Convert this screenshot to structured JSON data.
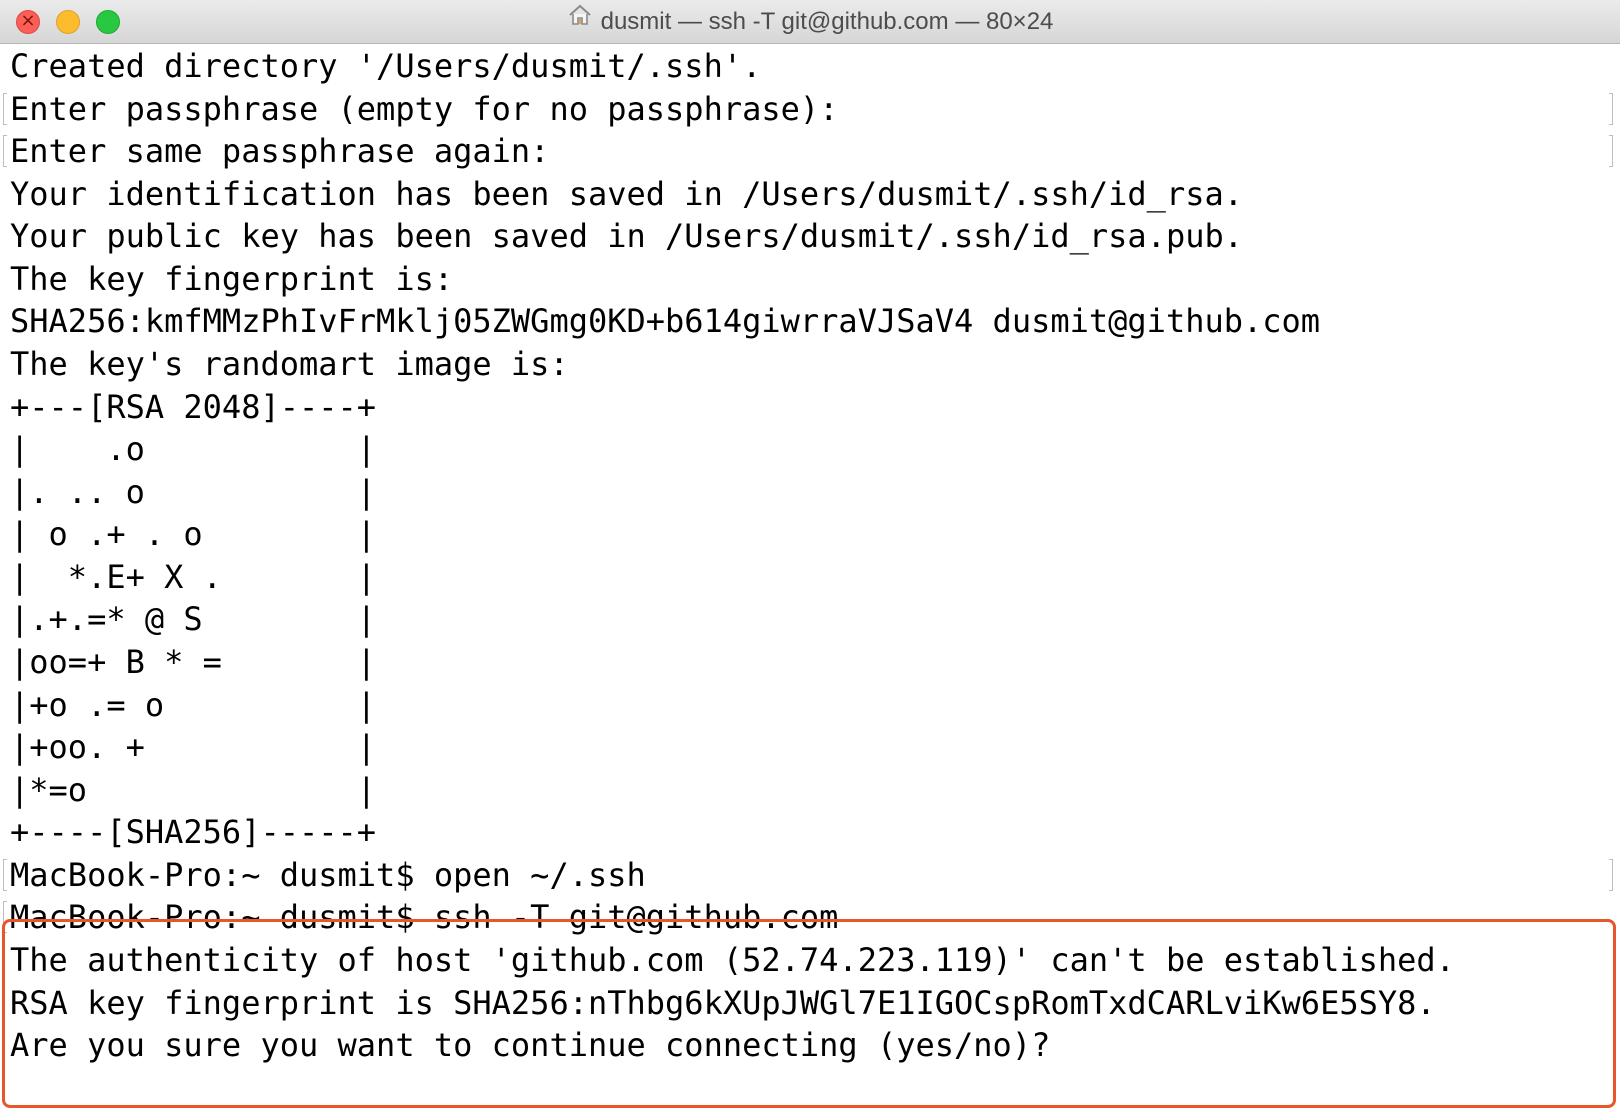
{
  "window": {
    "title": "dusmit — ssh -T git@github.com — 80×24",
    "title_icon": "home-icon",
    "traffic_lights": [
      "close",
      "minimize",
      "zoom"
    ],
    "colors": {
      "close": "#fc5f57",
      "minimize": "#fdbc2e",
      "zoom": "#28c940",
      "highlight_box": "#e8572a"
    }
  },
  "terminal": {
    "lines": [
      "Created directory '/Users/dusmit/.ssh'.",
      "Enter passphrase (empty for no passphrase):",
      "Enter same passphrase again:",
      "Your identification has been saved in /Users/dusmit/.ssh/id_rsa.",
      "Your public key has been saved in /Users/dusmit/.ssh/id_rsa.pub.",
      "The key fingerprint is:",
      "SHA256:kmfMMzPhIvFrMklj05ZWGmg0KD+b614giwrraVJSaV4 dusmit@github.com",
      "The key's randomart image is:",
      "+---[RSA 2048]----+",
      "|    .o           |",
      "|. .. o           |",
      "| o .+ . o        |",
      "|  *.E+ X .       |",
      "|.+.=* @ S        |",
      "|oo=+ B * =       |",
      "|+o .= o          |",
      "|+oo. +           |",
      "|*=o              |",
      "+----[SHA256]-----+",
      "MacBook-Pro:~ dusmit$ open ~/.ssh",
      "MacBook-Pro:~ dusmit$ ssh -T git@github.com",
      "The authenticity of host 'github.com (52.74.223.119)' can't be established.",
      "RSA key fingerprint is SHA256:nThbg6kXUpJWGl7E1IGOCspRomTxdCARLviKw6E5SY8.",
      "Are you sure you want to continue connecting (yes/no)?"
    ]
  }
}
